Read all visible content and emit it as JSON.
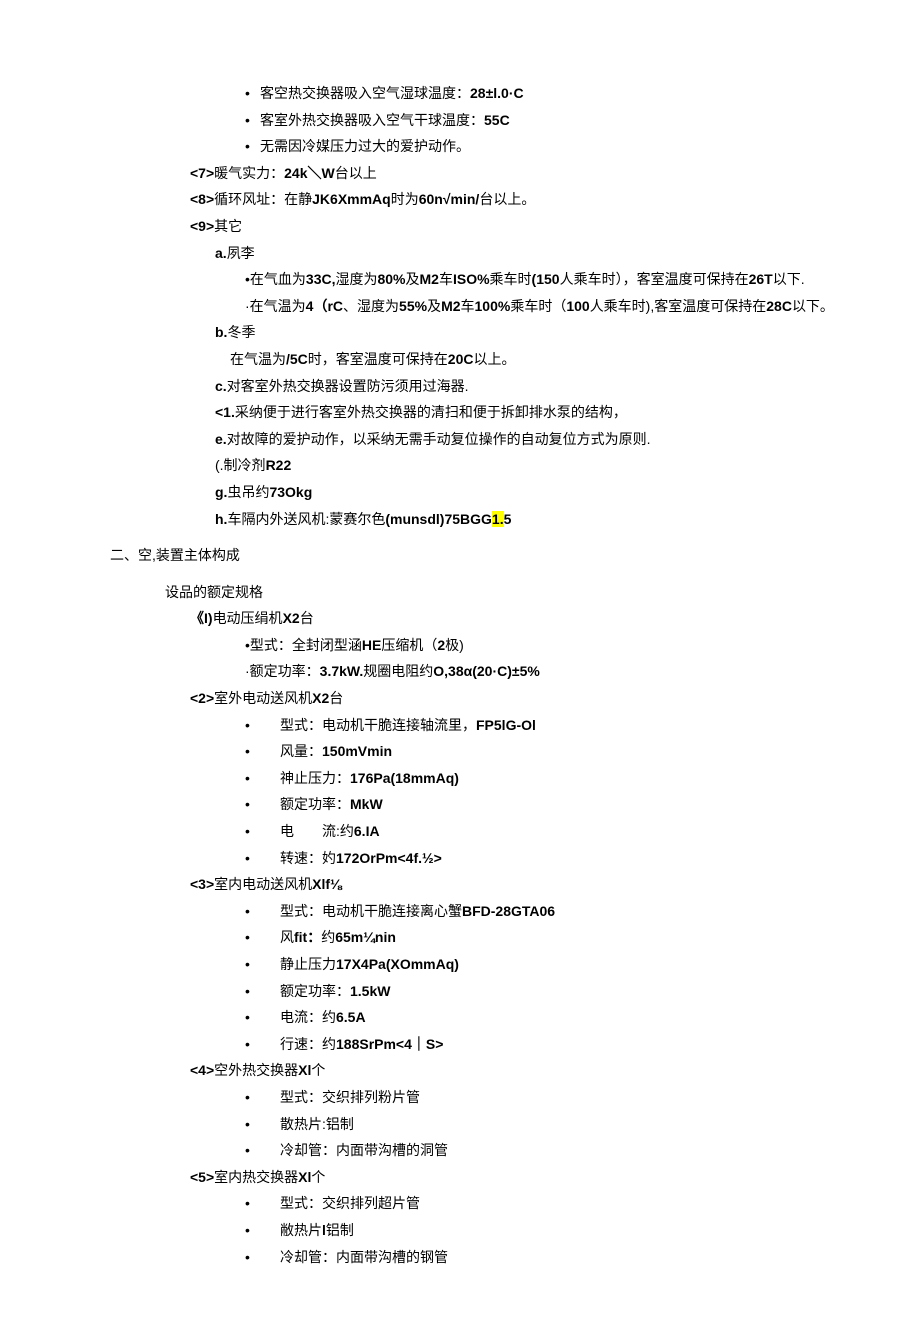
{
  "topBullets": [
    {
      "prefix": "客空热交换器吸入空气湿球温度：",
      "bold": "28±l.0·C"
    },
    {
      "prefix": "客室外热交换器吸入空气干球温度：",
      "bold": "55C"
    },
    {
      "prefix": "无需因冷媒压力过大的爱护动作。",
      "bold": ""
    }
  ],
  "line7": {
    "tag": "<7>",
    "t1": "暖气实力：",
    "b1": "24k＼W",
    "t2": "台以上"
  },
  "line8": {
    "tag": "<8>",
    "t1": "循环风址：在静",
    "b1": "JK6XmmAq",
    "t2": "时为",
    "b2": "60n√min/",
    "t3": "台以上。"
  },
  "line9": {
    "tag": "<9>",
    "t1": "其它"
  },
  "a_label": "a.",
  "a_text": "夙李",
  "a_sub1": {
    "p": "•在气血为",
    "b1": "33C,",
    "t1": "湿度为",
    "b2": "80%",
    "t2": "及",
    "b3": "M2",
    "t3": "车",
    "b4": "ISO%",
    "t4": "乘车时",
    "b5": "(150",
    "t5": "人乘车时），客室温度可保持在",
    "b6": "26T",
    "t6": "以下."
  },
  "a_sub2": {
    "p": "·在气温为",
    "b1": "4（rC",
    "t1": "、湿度为",
    "b2": "55%",
    "t2": "及",
    "b3": "M2",
    "t3": "车",
    "b4": "100%",
    "t4": "乘车时（",
    "b5": "100",
    "t5": "人乘车时),客室温度可保持在",
    "b6": "28C",
    "t6": "以下。"
  },
  "b_label": "b.",
  "b_text": "冬季",
  "b_sub": {
    "t1": "在气温为",
    "b1": "/5C",
    "t2": "时，客室温度可保持在",
    "b2": "20C",
    "t3": "以上。"
  },
  "c": {
    "b": "c.",
    "t": "对客室外热交换器设置防污须用过海器."
  },
  "c1": {
    "b": "<1.",
    "t": "采纳便于进行客室外热交换器的清扫和便于拆卸排水泵的结构，"
  },
  "e": {
    "b": "e.",
    "t": "对故障的爱护动作，以采纳无需手动复位操作的自动复位方式为原则."
  },
  "f": {
    "t": "(.制冷剂",
    "b": "R22"
  },
  "g": {
    "b1": "g.",
    "t": "虫吊约",
    "b2": "73Okg"
  },
  "h": {
    "b1": "h.",
    "t1": "车隔内外送风机:蒙赛尔色",
    "b2": "(munsdl)75BGG",
    "hl": "1.",
    "b3": "5"
  },
  "sec2": "二、空,装置主体构成",
  "sec2_sub": "设品的额定规格",
  "item1": {
    "p": "《I)",
    "t1": "电动压绢机",
    "b": "X2",
    "t2": "台"
  },
  "item1_s1": {
    "p": "•型式：全封闭型涵",
    "b": "HE",
    "t1": "压缩机（",
    "b2": "2",
    "t2": "极)"
  },
  "item1_s2": {
    "p": "·额定功率：",
    "b1": "3.7kW.",
    "t1": "规圈电阻约",
    "b2": "O,38α(20·C)±5%"
  },
  "item2": {
    "tag": "<2>",
    "t1": "室外电动送风机",
    "b": "X2",
    "t2": "台"
  },
  "item2_bullets": [
    {
      "t1": "型式：电动机干脆连接轴流里，",
      "b": "FP5lG-Ol"
    },
    {
      "t1": "风量：",
      "b": "150mVmin"
    },
    {
      "t1": "神止压力：",
      "b": "176Pa(18mmAq)"
    },
    {
      "t1": "额定功率：",
      "b": "MkW"
    },
    {
      "t1": "电　　流:约",
      "b": "6.IA"
    },
    {
      "t1": "转速：妁",
      "b": "172OrPm<4f.½>"
    }
  ],
  "item3": {
    "tag": "<3>",
    "t1": "室内电动送风机",
    "b": "Xlf⅛"
  },
  "item3_bullets": [
    {
      "t1": "型式：电动机干脆连接离心蟹",
      "b": "BFD-28GTA06"
    },
    {
      "t1": "风",
      "b1": "fit：",
      "t2": "约",
      "b2": "65m¼nin"
    },
    {
      "t1": "静止压力",
      "b": "17X4Pa(XOmmAq)"
    },
    {
      "t1": "额定功率：",
      "b": "1.5kW"
    },
    {
      "t1": "电流：约",
      "b": "6.5A"
    },
    {
      "t1": "行速：约",
      "b": "188SrPm<4｜S>"
    }
  ],
  "item4": {
    "tag": "<4>",
    "t1": "空外热交换器",
    "b": "Xl",
    "t2": "个"
  },
  "item4_bullets": [
    {
      "t": "型式：交织排列粉片管"
    },
    {
      "t": "散热片:铝制"
    },
    {
      "t": "冷却管：内面带沟槽的洞管"
    }
  ],
  "item5": {
    "tag": "<5>",
    "t1": "室内热交换器",
    "b": "Xl",
    "t2": "个"
  },
  "item5_bullets": [
    {
      "t": "型式：交织排列超片管"
    },
    {
      "t1": "敝热片",
      "b": "l",
      "t2": "铝制"
    },
    {
      "t": "冷却管：内面带沟槽的钢管"
    }
  ]
}
